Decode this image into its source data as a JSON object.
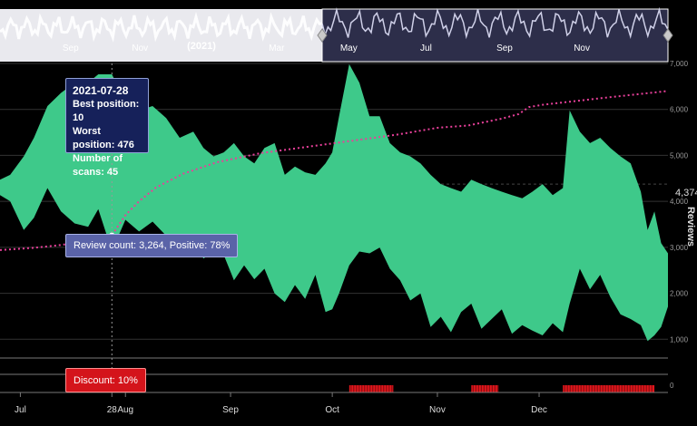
{
  "chart_data": {
    "type": "area",
    "x_range": [
      "2021-06-25",
      "2022-01-08"
    ],
    "primary_area": {
      "color": "#3ec98a",
      "points": [
        [
          "2021-06-25",
          100,
          140
        ],
        [
          "2021-06-28",
          90,
          160
        ],
        [
          "2021-07-02",
          60,
          300
        ],
        [
          "2021-07-05",
          40,
          230
        ],
        [
          "2021-07-09",
          20,
          120
        ],
        [
          "2021-07-13",
          15,
          200
        ],
        [
          "2021-07-17",
          12,
          260
        ],
        [
          "2021-07-21",
          12,
          280
        ],
        [
          "2021-07-24",
          10,
          190
        ],
        [
          "2021-07-28",
          10,
          476
        ],
        [
          "2021-08-01",
          18,
          240
        ],
        [
          "2021-08-05",
          22,
          310
        ],
        [
          "2021-08-09",
          20,
          250
        ],
        [
          "2021-08-13",
          26,
          340
        ],
        [
          "2021-08-17",
          40,
          420
        ],
        [
          "2021-08-21",
          35,
          360
        ],
        [
          "2021-08-24",
          50,
          560
        ],
        [
          "2021-08-27",
          60,
          480
        ],
        [
          "2021-08-30",
          55,
          520
        ],
        [
          "2021-09-02",
          45,
          900
        ],
        [
          "2021-09-05",
          60,
          650
        ],
        [
          "2021-09-08",
          70,
          880
        ],
        [
          "2021-09-11",
          50,
          700
        ],
        [
          "2021-09-14",
          45,
          1200
        ],
        [
          "2021-09-17",
          90,
          1450
        ],
        [
          "2021-09-20",
          75,
          1000
        ],
        [
          "2021-09-23",
          85,
          1350
        ],
        [
          "2021-09-26",
          90,
          800
        ],
        [
          "2021-09-29",
          70,
          1800
        ],
        [
          "2021-10-01",
          55,
          1700
        ],
        [
          "2021-10-03",
          25,
          1200
        ],
        [
          "2021-10-06",
          8,
          650
        ],
        [
          "2021-10-09",
          12,
          480
        ],
        [
          "2021-10-12",
          25,
          500
        ],
        [
          "2021-10-15",
          25,
          440
        ],
        [
          "2021-10-18",
          45,
          700
        ],
        [
          "2021-10-21",
          55,
          900
        ],
        [
          "2021-10-24",
          60,
          1400
        ],
        [
          "2021-10-27",
          70,
          1200
        ],
        [
          "2021-10-30",
          90,
          2500
        ],
        [
          "2021-11-02",
          110,
          2000
        ],
        [
          "2021-11-05",
          120,
          2800
        ],
        [
          "2021-11-08",
          130,
          1800
        ],
        [
          "2021-11-11",
          100,
          1500
        ],
        [
          "2021-11-14",
          110,
          2600
        ],
        [
          "2021-11-17",
          120,
          2100
        ],
        [
          "2021-11-20",
          130,
          1700
        ],
        [
          "2021-11-23",
          140,
          2900
        ],
        [
          "2021-11-26",
          150,
          2400
        ],
        [
          "2021-11-29",
          130,
          2700
        ],
        [
          "2021-12-02",
          110,
          3000
        ],
        [
          "2021-12-05",
          140,
          2300
        ],
        [
          "2021-12-08",
          120,
          2800
        ],
        [
          "2021-12-10",
          22,
          1500
        ],
        [
          "2021-12-13",
          35,
          700
        ],
        [
          "2021-12-16",
          45,
          1100
        ],
        [
          "2021-12-19",
          40,
          800
        ],
        [
          "2021-12-22",
          50,
          1300
        ],
        [
          "2021-12-25",
          60,
          1900
        ],
        [
          "2021-12-28",
          70,
          2100
        ],
        [
          "2021-12-31",
          130,
          2400
        ],
        [
          "2022-01-02",
          300,
          3400
        ],
        [
          "2022-01-04",
          200,
          3000
        ],
        [
          "2022-01-06",
          400,
          2500
        ],
        [
          "2022-01-08",
          500,
          1600
        ]
      ]
    },
    "review_count": {
      "color": "#e8409a",
      "axis_label": "Reviews",
      "ylim": [
        0,
        7000
      ],
      "y_ticks": [
        "0",
        "1,000",
        "2,000",
        "3,000",
        "4,000",
        "5,000",
        "6,000",
        "7,000"
      ],
      "points": [
        [
          "2021-06-25",
          2940
        ],
        [
          "2021-07-05",
          2990
        ],
        [
          "2021-07-13",
          3050
        ],
        [
          "2021-07-20",
          3130
        ],
        [
          "2021-07-24",
          3200
        ],
        [
          "2021-07-28",
          3264
        ],
        [
          "2021-08-01",
          3700
        ],
        [
          "2021-08-05",
          4000
        ],
        [
          "2021-08-10",
          4300
        ],
        [
          "2021-08-18",
          4600
        ],
        [
          "2021-08-28",
          4850
        ],
        [
          "2021-09-10",
          5050
        ],
        [
          "2021-09-25",
          5200
        ],
        [
          "2021-10-05",
          5300
        ],
        [
          "2021-10-20",
          5450
        ],
        [
          "2021-11-01",
          5600
        ],
        [
          "2021-11-10",
          5650
        ],
        [
          "2021-11-20",
          5800
        ],
        [
          "2021-11-25",
          5900
        ],
        [
          "2021-11-28",
          6050
        ],
        [
          "2021-12-02",
          6100
        ],
        [
          "2021-12-20",
          6250
        ],
        [
          "2022-01-08",
          6400
        ]
      ]
    },
    "discounts": {
      "color": "#e0161c",
      "periods": [
        [
          "2021-10-06",
          "2021-10-19"
        ],
        [
          "2021-11-11",
          "2021-11-19"
        ],
        [
          "2021-12-08",
          "2022-01-04"
        ]
      ]
    },
    "x_ticks": [
      {
        "label": "Jul",
        "date": "2021-07-01"
      },
      {
        "label": "28",
        "date": "2021-07-28"
      },
      {
        "label": "Aug",
        "date": "2021-08-01"
      },
      {
        "label": "Sep",
        "date": "2021-09-01"
      },
      {
        "label": "Oct",
        "date": "2021-10-01"
      },
      {
        "label": "Nov",
        "date": "2021-11-01"
      },
      {
        "label": "Dec",
        "date": "2021-12-01"
      }
    ],
    "last_value_label": "4,374",
    "navigator": {
      "year_label": "(2021)",
      "ticks_left": [
        {
          "label": "Sep",
          "date": "2020-09-01"
        },
        {
          "label": "Nov",
          "date": "2020-11-01"
        },
        {
          "label": "Mar",
          "date": "2021-03-01"
        }
      ],
      "ticks_right": [
        {
          "label": "May",
          "date": "2021-05-01"
        },
        {
          "label": "Jul",
          "date": "2021-07-01"
        },
        {
          "label": "Sep",
          "date": "2021-09-01"
        },
        {
          "label": "Nov",
          "date": "2021-11-01"
        }
      ]
    }
  },
  "tooltip": {
    "date": "2021-07-28",
    "best": "Best position: 10",
    "worst": "Worst position: 476",
    "scans": "Number of scans: 45"
  },
  "review_tooltip": "Review count: 3,264, Positive: 78%",
  "discount_tooltip": "Discount: 10%"
}
